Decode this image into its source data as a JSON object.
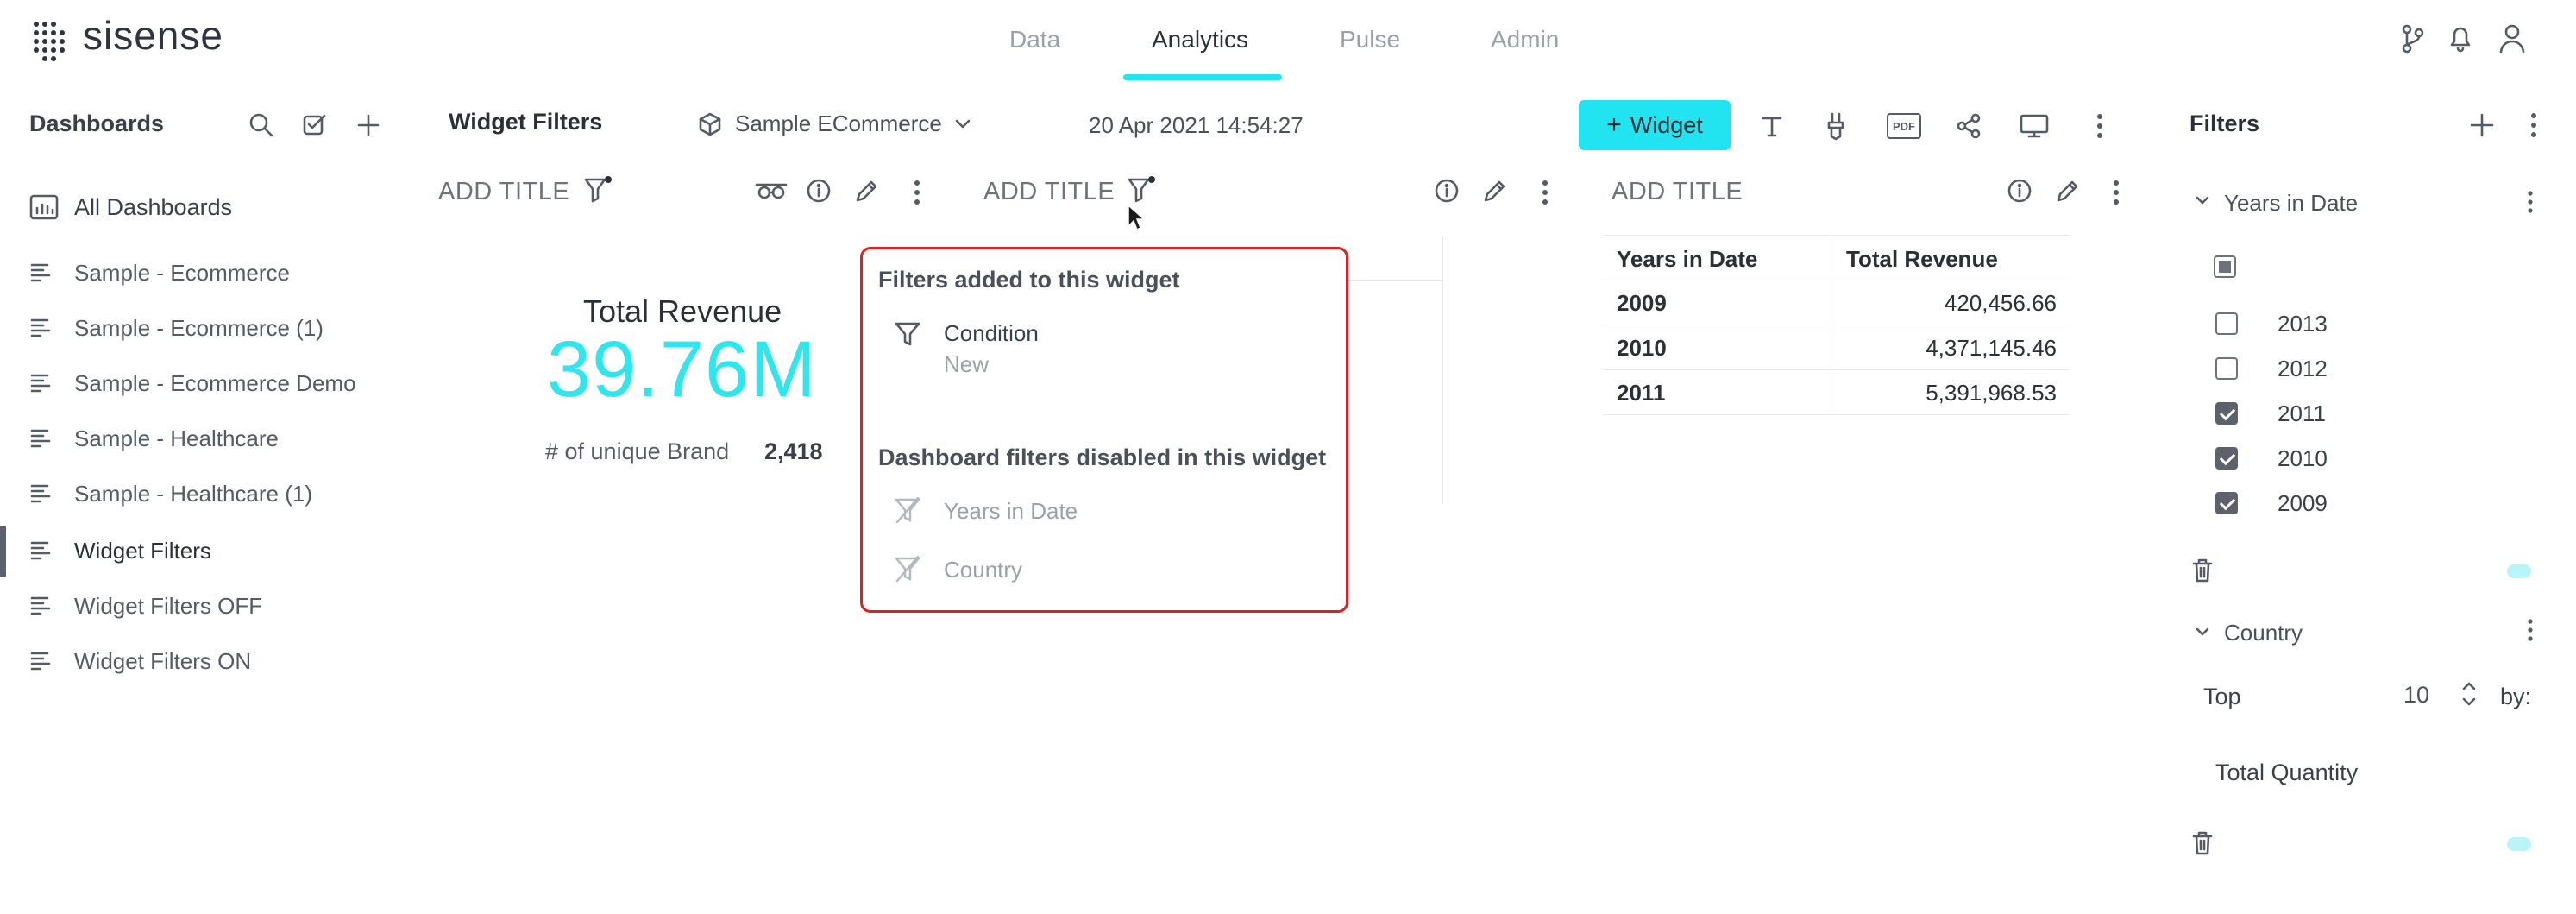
{
  "app": {
    "logo_text": "sisense"
  },
  "nav": {
    "tabs": [
      "Data",
      "Analytics",
      "Pulse",
      "Admin"
    ],
    "active": "Analytics"
  },
  "sidebar": {
    "title": "Dashboards",
    "all_dashboards": "All Dashboards",
    "items": [
      "Sample - Ecommerce",
      "Sample - Ecommerce (1)",
      "Sample - Ecommerce Demo",
      "Sample - Healthcare",
      "Sample - Healthcare (1)",
      "Widget Filters",
      "Widget Filters OFF",
      "Widget Filters ON"
    ],
    "active_item": "Widget Filters"
  },
  "toolbar": {
    "dashboard_name": "Widget Filters",
    "datasource": "Sample ECommerce",
    "timestamp": "20 Apr 2021 14:54:27",
    "widget_button": "Widget",
    "pdf_label": "PDF"
  },
  "widgets": {
    "w1": {
      "title": "ADD TITLE",
      "kpi_label": "Total Revenue",
      "kpi_value": "39.76M",
      "secondary_label": "# of unique Brand",
      "secondary_value": "2,418"
    },
    "w2": {
      "title": "ADD TITLE"
    },
    "w3": {
      "title": "ADD TITLE",
      "columns": [
        "Years in Date",
        "Total Revenue"
      ],
      "rows": [
        {
          "year": "2009",
          "revenue": "420,456.66"
        },
        {
          "year": "2010",
          "revenue": "4,371,145.46"
        },
        {
          "year": "2011",
          "revenue": "5,391,968.53"
        }
      ]
    }
  },
  "popup": {
    "added_header": "Filters added to this widget",
    "added": [
      {
        "name": "Condition",
        "value": "New"
      }
    ],
    "disabled_header": "Dashboard filters disabled in this widget",
    "disabled": [
      "Years in Date",
      "Country"
    ]
  },
  "filters_panel": {
    "title": "Filters",
    "years": {
      "title": "Years in Date",
      "options": [
        {
          "label": "2013",
          "checked": false
        },
        {
          "label": "2012",
          "checked": false
        },
        {
          "label": "2011",
          "checked": true
        },
        {
          "label": "2010",
          "checked": true
        },
        {
          "label": "2009",
          "checked": true
        }
      ]
    },
    "country": {
      "title": "Country",
      "top_label": "Top",
      "top_value": "10",
      "by_label": "by:",
      "measure": "Total Quantity"
    }
  },
  "colors": {
    "accent": "#22e4f0",
    "kpi": "#2ee6ee",
    "popup_border": "#e0201e",
    "text": "#3a3f4a"
  }
}
